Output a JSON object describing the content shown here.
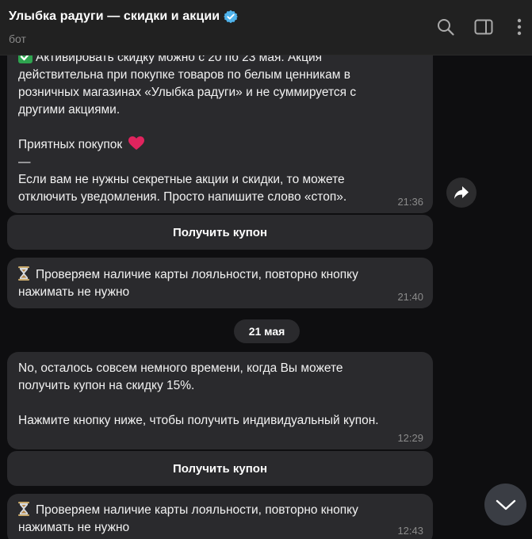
{
  "header": {
    "title": "Улыбка радуги — скидки и акции",
    "subtitle": "бот"
  },
  "messages": {
    "m1": {
      "line1": "Активировать скидку можно с 20 по 23 мая. Акция",
      "line2": "действительна при покупке товаров по белым ценникам в",
      "line3": "розничных магазинах «Улыбка радуги» и не суммируется с",
      "line4": "другими акциями.",
      "line5": "Приятных покупок",
      "line6": "—",
      "line7": "Если вам не нужны секретные акции и скидки, то можете",
      "line8": "отключить уведомления. Просто напишите слово «стоп».",
      "time": "21:36"
    },
    "btn1": "Получить купон",
    "m2": {
      "line1": "Проверяем наличие карты лояльности, повторно кнопку",
      "line2": "нажимать не нужно",
      "time": "21:40"
    },
    "date": "21 мая",
    "m3": {
      "line1": "No, осталось совсем немного времени, когда Вы можете",
      "line2": "получить купон на скидку 15%.",
      "line3": "Нажмите кнопку ниже, чтобы получить индивидуальный купон.",
      "time": "12:29"
    },
    "btn2": "Получить купон",
    "m4": {
      "line1": "Проверяем наличие карты лояльности, повторно кнопку",
      "line2": "нажимать не нужно",
      "time": "12:43"
    }
  },
  "icons": {
    "verified": "verified-badge-icon",
    "search": "search-icon",
    "sidebar": "sidebar-toggle-icon",
    "menu": "more-vertical-icon",
    "share": "share-forward-icon",
    "scroll": "chevron-down-icon",
    "check": "check-mark-emoji",
    "heart": "heart-emoji",
    "hourglass": "hourglass-emoji"
  },
  "colors": {
    "accent": "#4fb3ec",
    "bubble": "#2a2a2d",
    "background": "#0e0e10",
    "header": "#212121",
    "check_green": "#2ea44f",
    "heart_red": "#e0245e"
  }
}
